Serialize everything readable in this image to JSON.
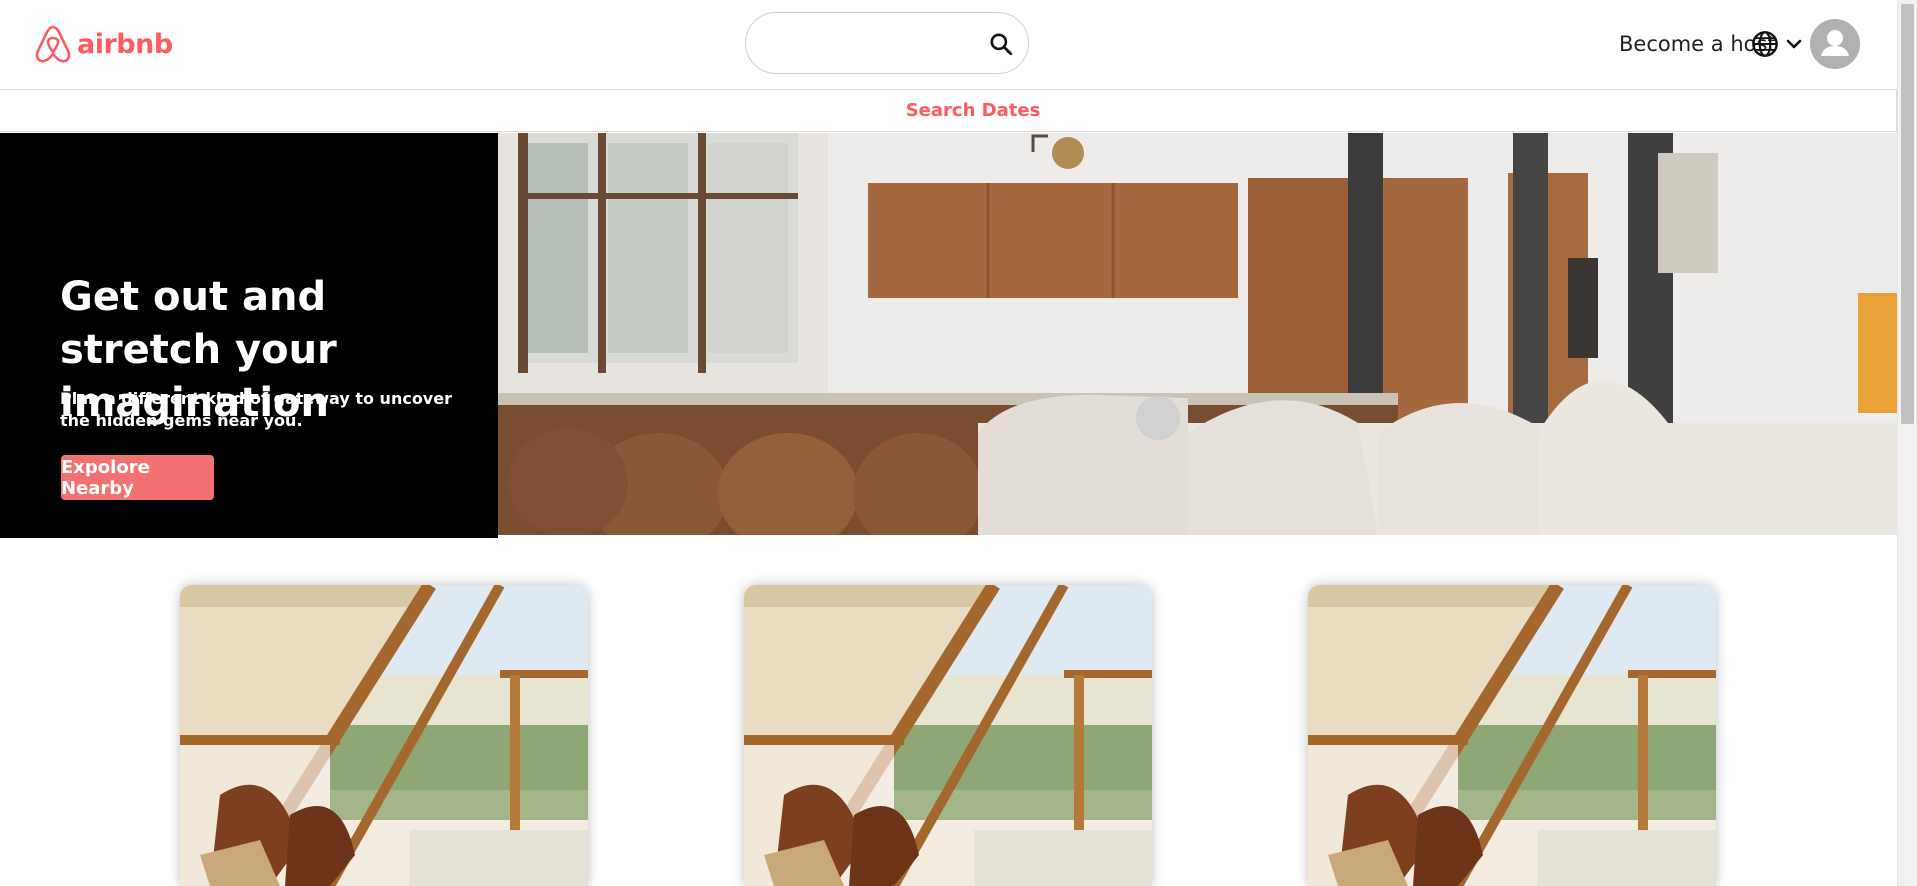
{
  "header": {
    "logo_text": "airbnb",
    "search": {
      "value": "",
      "placeholder": ""
    },
    "host_label": "Become a host",
    "icons": [
      "airbnb-logo-icon",
      "search-icon",
      "globe-icon",
      "chevron-down-icon",
      "user-avatar-icon"
    ]
  },
  "dates_bar": {
    "label": "Search Dates"
  },
  "hero": {
    "title": "Get out and stretch your imagination",
    "subtitle": "Plan a different kind of gateway to uncover the hidden gems near you.",
    "button_label": "Expolore Nearby"
  },
  "cards": [
    {
      "image": "a-frame-cabin-interior"
    },
    {
      "image": "a-frame-cabin-interior"
    },
    {
      "image": "a-frame-cabin-interior"
    }
  ],
  "colors": {
    "brand": "#ff5a5f",
    "button": "#f27171",
    "hero_bg": "#000000"
  }
}
